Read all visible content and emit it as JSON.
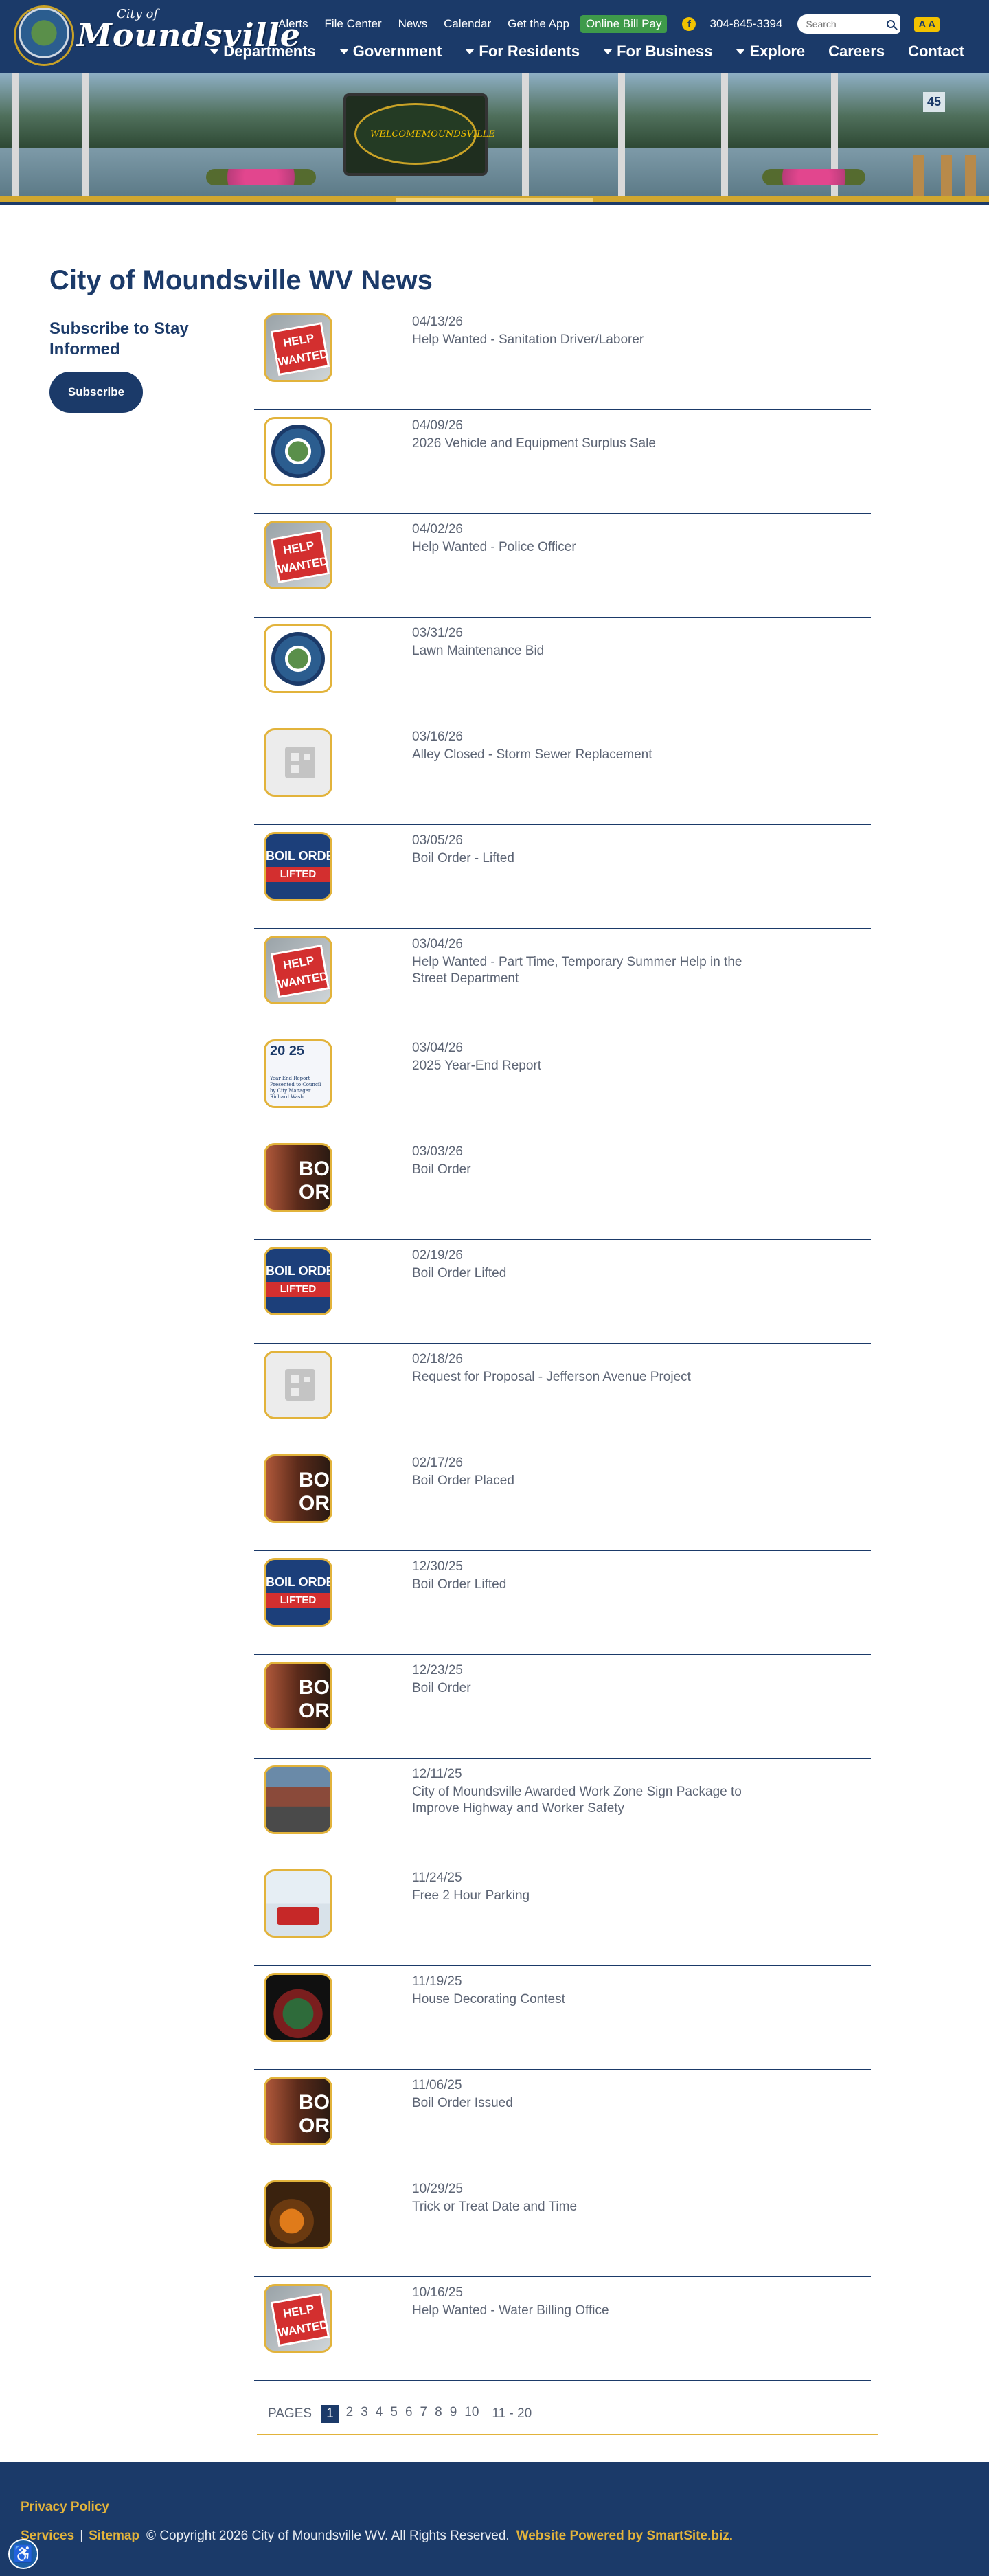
{
  "header": {
    "logo_small": "City of",
    "logo_big": "Moundsville",
    "utility_links": [
      "Alerts",
      "File Center",
      "News",
      "Calendar",
      "Get the App"
    ],
    "bill_pay": "Online Bill Pay",
    "phone": "304-845-3394",
    "search_placeholder": "Search",
    "text_size": "A A",
    "nav": [
      "Departments",
      "Government",
      "For Residents",
      "For Business",
      "Explore",
      "Careers",
      "Contact"
    ]
  },
  "hero": {
    "sign_left": "WELCOME",
    "sign_right": "MOUNDSVILLE",
    "marker": "45"
  },
  "page": {
    "title": "City of Moundsville WV News",
    "subscribe_title": "Subscribe to Stay Informed",
    "subscribe_button": "Subscribe"
  },
  "news": [
    {
      "date": "04/13/26",
      "title": "Help Wanted - Sanitation Driver/Laborer",
      "thumb": "help-wanted"
    },
    {
      "date": "04/09/26",
      "title": "2026 Vehicle and Equipment Surplus Sale",
      "thumb": "city-seal"
    },
    {
      "date": "04/02/26",
      "title": "Help Wanted - Police Officer",
      "thumb": "help-wanted"
    },
    {
      "date": "03/31/26",
      "title": "Lawn Maintenance Bid",
      "thumb": "city-seal"
    },
    {
      "date": "03/16/26",
      "title": "Alley Closed - Storm Sewer Replacement",
      "thumb": "news-placeholder"
    },
    {
      "date": "03/05/26",
      "title": "Boil Order - Lifted",
      "thumb": "boil-order-lifted"
    },
    {
      "date": "03/04/26",
      "title": "Help Wanted - Part Time, Temporary Summer Help in the Street Department",
      "thumb": "help-wanted"
    },
    {
      "date": "03/04/26",
      "title": "2025 Year-End Report",
      "thumb": "year-end-report"
    },
    {
      "date": "03/03/26",
      "title": "Boil Order",
      "thumb": "boil-order"
    },
    {
      "date": "02/19/26",
      "title": "Boil Order Lifted",
      "thumb": "boil-order-lifted"
    },
    {
      "date": "02/18/26",
      "title": "Request for Proposal - Jefferson Avenue Project",
      "thumb": "news-placeholder"
    },
    {
      "date": "02/17/26",
      "title": "Boil Order Placed",
      "thumb": "boil-order"
    },
    {
      "date": "12/30/25",
      "title": "Boil Order Lifted",
      "thumb": "boil-order-lifted"
    },
    {
      "date": "12/23/25",
      "title": "Boil Order",
      "thumb": "boil-order"
    },
    {
      "date": "12/11/25",
      "title": "City of Moundsville Awarded Work Zone Sign Package to Improve Highway and Worker Safety",
      "thumb": "work-zone"
    },
    {
      "date": "11/24/25",
      "title": "Free 2 Hour Parking",
      "thumb": "holiday-truck"
    },
    {
      "date": "11/19/25",
      "title": "House Decorating Contest",
      "thumb": "holiday-house"
    },
    {
      "date": "11/06/25",
      "title": "Boil Order Issued",
      "thumb": "boil-order"
    },
    {
      "date": "10/29/25",
      "title": "Trick or Treat Date and Time",
      "thumb": "halloween"
    },
    {
      "date": "10/16/25",
      "title": "Help Wanted - Water Billing Office",
      "thumb": "help-wanted"
    }
  ],
  "thumb_text": {
    "help": "HELP",
    "wanted": "WANTED",
    "boil_order": "BOIL ORDER",
    "lifted": "LIFTED",
    "bo": "BO",
    "ord": "ORD",
    "report_year": "20 25",
    "report_caption": "Year End Report Presented to Council by City Manager Richard Wash"
  },
  "pager": {
    "label": "PAGES",
    "pages": [
      "1",
      "2",
      "3",
      "4",
      "5",
      "6",
      "7",
      "8",
      "9",
      "10"
    ],
    "current": "1",
    "range": "11 - 20"
  },
  "footer": {
    "privacy": "Privacy Policy",
    "services": "Services",
    "sitemap": "Sitemap",
    "copyright": "© Copyright 2026 City of Moundsville WV.  All Rights Reserved.",
    "powered": "Website Powered by SmartSite.biz."
  },
  "colors": {
    "navy": "#1b3a69",
    "gold": "#e2b33b",
    "green": "#3e9a4a",
    "yellow": "#f2c200"
  }
}
